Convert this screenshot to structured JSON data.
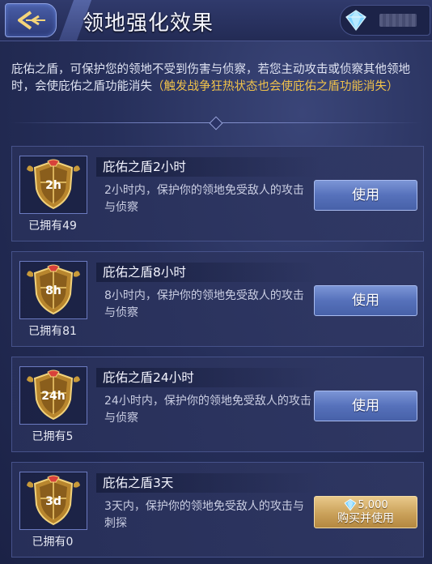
{
  "header": {
    "title": "领地强化效果"
  },
  "description": {
    "main": "庇佑之盾，可保护您的领地不受到伤害与侦察，若您主动攻击或侦察其他领地时，会使庇佑之盾功能消失",
    "highlight": "（触发战争狂热状态也会使庇佑之盾功能消失）"
  },
  "items": [
    {
      "badge": "2h",
      "name": "庇佑之盾2小时",
      "desc": "2小时内，保护你的领地免受敌人的攻击与侦察",
      "owned": "已拥有49",
      "button": "使用"
    },
    {
      "badge": "8h",
      "name": "庇佑之盾8小时",
      "desc": "8小时内，保护你的领地免受敌人的攻击与侦察",
      "owned": "已拥有81",
      "button": "使用"
    },
    {
      "badge": "24h",
      "name": "庇佑之盾24小时",
      "desc": "24小时内，保护你的领地免受敌人的攻击与侦察",
      "owned": "已拥有5",
      "button": "使用"
    },
    {
      "badge": "3d",
      "name": "庇佑之盾3天",
      "desc": "3天内，保护你的领地免受敌人的攻击与刺探",
      "owned": "已拥有0",
      "price": "5,000",
      "button": "购买并使用"
    }
  ],
  "colors": {
    "highlight": "#f0c24a",
    "use_button": "#5671bb",
    "buy_button": "#caa15a"
  },
  "icons": {
    "back": "back-arrow-icon",
    "currency": "diamond-gem-icon",
    "item": "shield-icon"
  }
}
